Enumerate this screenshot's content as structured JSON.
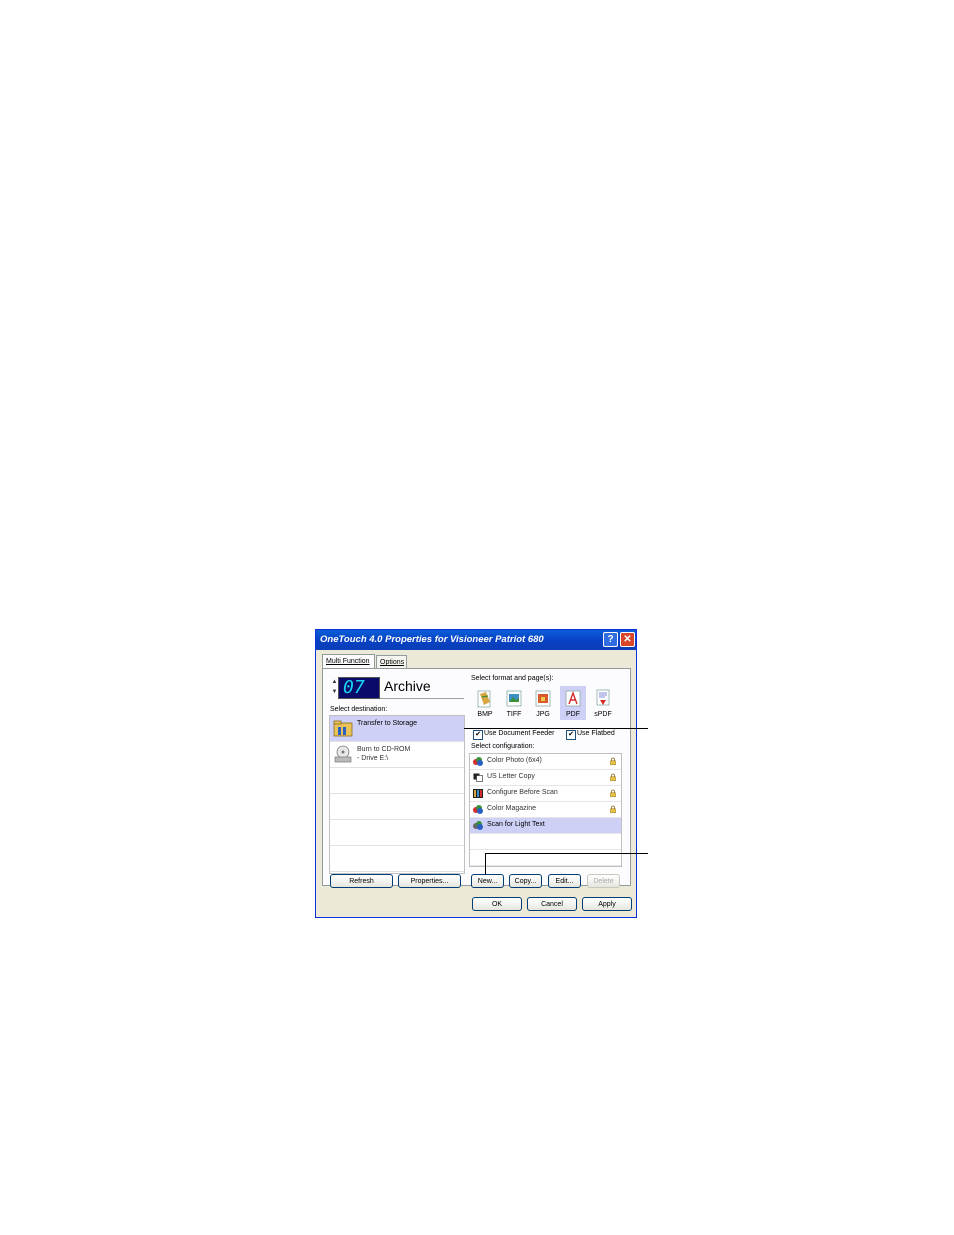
{
  "window": {
    "title": "OneTouch 4.0 Properties for Visioneer Patriot 680",
    "tabs": [
      "Multi Function",
      "Options"
    ]
  },
  "button": {
    "number": "07",
    "name": "Archive"
  },
  "destination": {
    "label": "Select destination:",
    "items": [
      {
        "line1": "Transfer to Storage",
        "line2": "",
        "icon": "folder-storage-icon",
        "selected": true
      },
      {
        "line1": "Burn to CD-ROM",
        "line2": "- Drive E:\\",
        "icon": "cd-burner-icon",
        "selected": false
      }
    ],
    "refresh": "Refresh",
    "properties": "Properties..."
  },
  "format": {
    "label": "Select format and page(s):",
    "items": [
      {
        "label": "BMP",
        "selected": false,
        "color": "#d7a640"
      },
      {
        "label": "TIFF",
        "selected": false,
        "color": "#3c8ec7"
      },
      {
        "label": "JPG",
        "selected": false,
        "color": "#d85a2b"
      },
      {
        "label": "PDF",
        "selected": true,
        "color": "#d62c2c"
      },
      {
        "label": "sPDF",
        "selected": false,
        "color": "#5566cc"
      }
    ],
    "use_feeder": "Use Document Feeder",
    "use_flatbed": "Use Flatbed"
  },
  "configuration": {
    "label": "Select configuration:",
    "items": [
      {
        "label": "Color Photo (6x4)",
        "icon": "color-photo-icon",
        "locked": true,
        "selected": false
      },
      {
        "label": "US Letter Copy",
        "icon": "copy-icon",
        "locked": true,
        "selected": false
      },
      {
        "label": "Configure Before Scan",
        "icon": "configure-icon",
        "locked": true,
        "selected": false
      },
      {
        "label": "Color Magazine",
        "icon": "color-magazine-icon",
        "locked": true,
        "selected": false
      },
      {
        "label": "Scan for Light Text",
        "icon": "light-text-icon",
        "locked": false,
        "selected": true
      }
    ],
    "new": "New...",
    "copy": "Copy...",
    "edit": "Edit...",
    "delete": "Delete"
  },
  "dialog": {
    "ok": "OK",
    "cancel": "Cancel",
    "apply": "Apply"
  },
  "colors": {
    "titlebar": "#0842c4",
    "selection": "#cfd0f5",
    "lcd_bg": "#0a0a6a",
    "lcd_digit": "#19d5f2"
  }
}
